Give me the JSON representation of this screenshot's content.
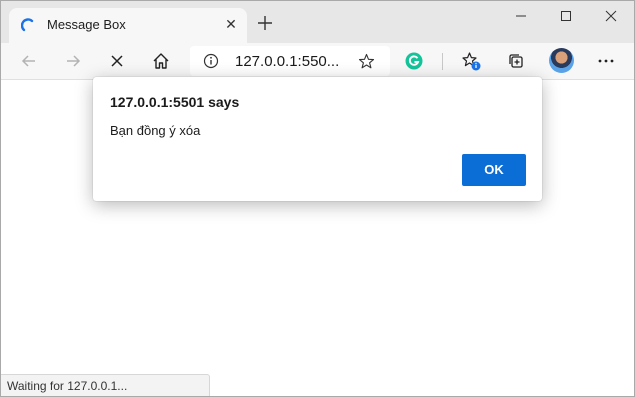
{
  "tab": {
    "title": "Message Box",
    "close": "✕",
    "new_tab": "+"
  },
  "toolbar": {
    "address": "127.0.0.1:550..."
  },
  "dialog": {
    "title": "127.0.0.1:5501 says",
    "message": "Bạn đồng ý xóa",
    "ok_label": "OK"
  },
  "status": {
    "text": "Waiting for 127.0.0.1..."
  },
  "colors": {
    "accent": "#0b6ed7",
    "grammarly": "#15c39a",
    "badge": "#1a73e8"
  }
}
